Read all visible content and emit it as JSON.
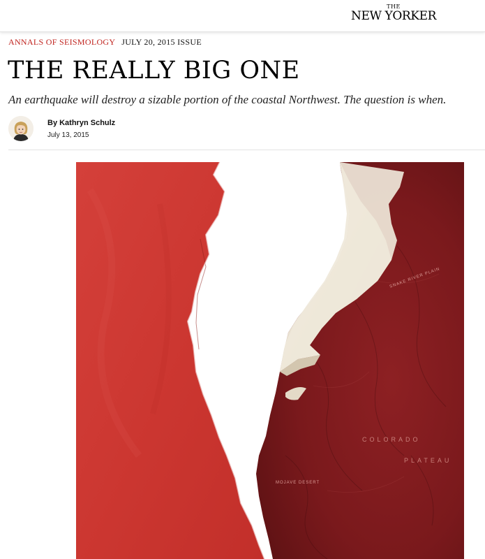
{
  "masthead": {
    "logo_the": "THE",
    "logo_name": "NEW YORKER"
  },
  "article": {
    "rubric": "Annals of Seismology",
    "issue": "July 20, 2015 Issue",
    "headline": "THE REALLY BIG ONE",
    "dek": "An earthquake will destroy a sizable portion of the coastal Northwest. The question is when.",
    "byline": "By Kathryn Schulz",
    "date": "July 13, 2015"
  },
  "colors": {
    "accent": "#c0231e",
    "map_left": "#cf3b35",
    "map_right": "#7d1a1c",
    "paper": "#e9e2d4"
  },
  "illustration": {
    "map_labels": [
      "SNAKE RIVER PLAIN",
      "MOJAVE DESERT",
      "COLORADO",
      "PLATEAU"
    ]
  }
}
